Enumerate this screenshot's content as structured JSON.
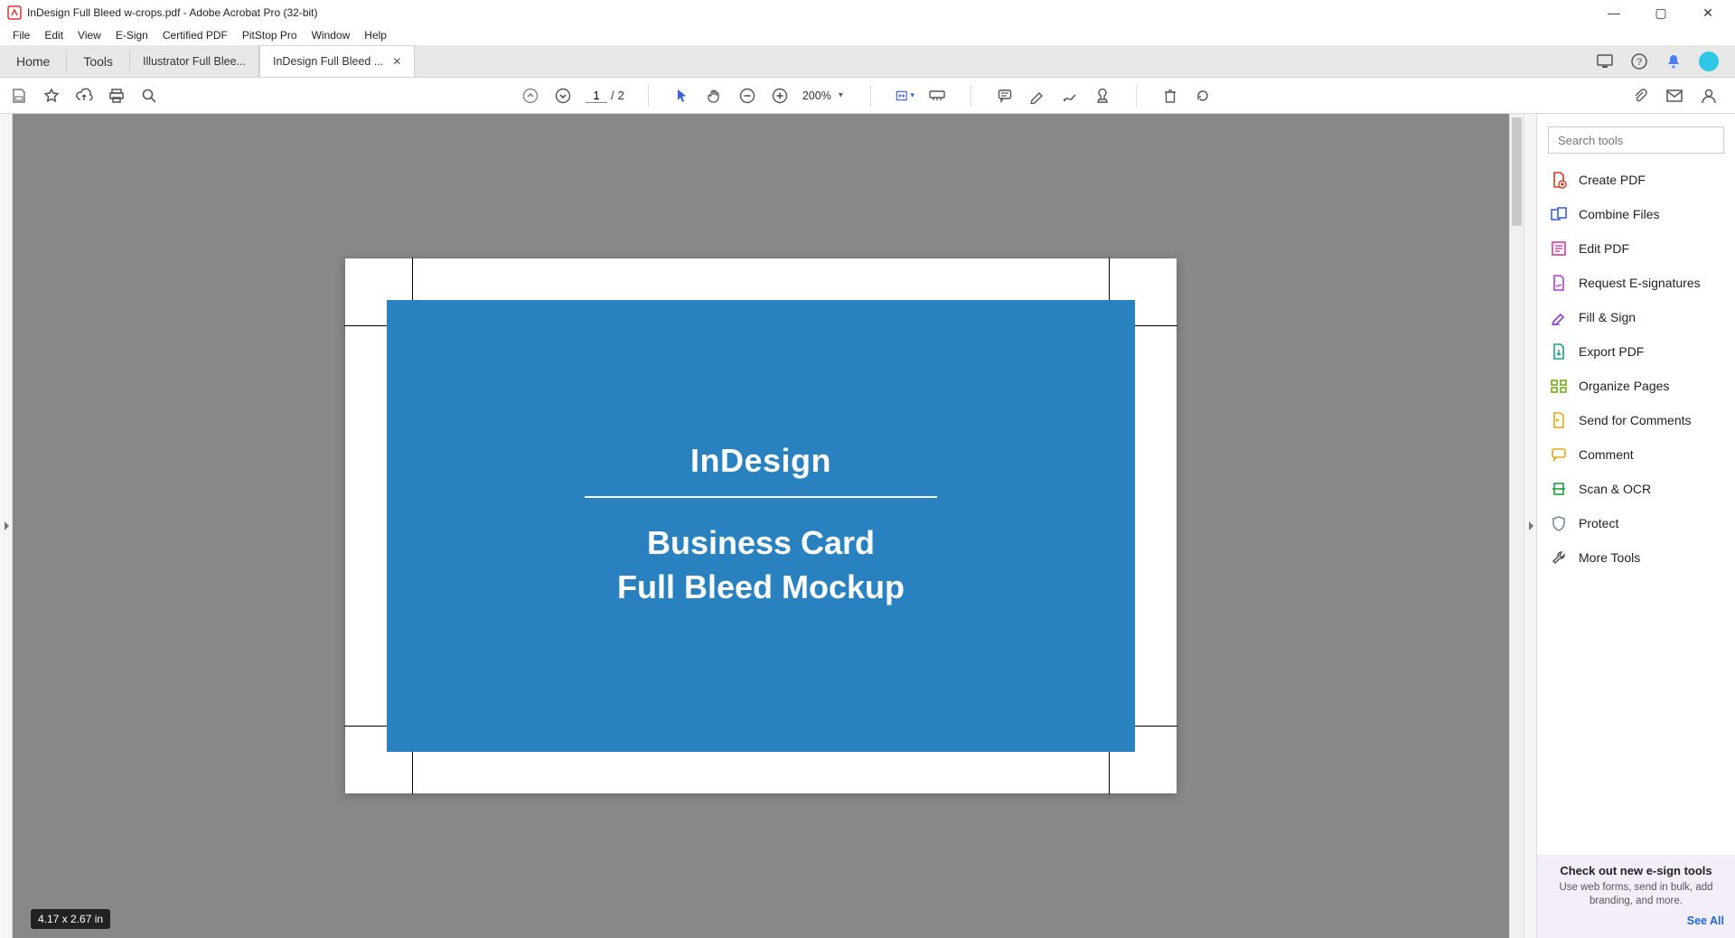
{
  "window": {
    "title": "InDesign Full Bleed w-crops.pdf - Adobe Acrobat Pro (32-bit)"
  },
  "menu": [
    "File",
    "Edit",
    "View",
    "E-Sign",
    "Certified PDF",
    "PitStop Pro",
    "Window",
    "Help"
  ],
  "tabs": {
    "home": "Home",
    "tools": "Tools",
    "docs": [
      {
        "label": "Illustrator Full Blee...",
        "active": false
      },
      {
        "label": "InDesign Full Bleed ...",
        "active": true
      }
    ]
  },
  "toolbar": {
    "page_current": "1",
    "page_sep": "/",
    "page_total": "2",
    "zoom": "200%"
  },
  "document": {
    "title_line": "InDesign",
    "subtitle_line1": "Business Card",
    "subtitle_line2": "Full Bleed Mockup"
  },
  "right_panel": {
    "search_placeholder": "Search tools",
    "tools": [
      {
        "label": "Create PDF",
        "color": "#d63b2a",
        "icon": "file-plus"
      },
      {
        "label": "Combine Files",
        "color": "#3b63d6",
        "icon": "combine"
      },
      {
        "label": "Edit PDF",
        "color": "#d63ba9",
        "icon": "edit-pdf"
      },
      {
        "label": "Request E-signatures",
        "color": "#b23bd6",
        "icon": "signature"
      },
      {
        "label": "Fill & Sign",
        "color": "#8a3bd6",
        "icon": "pen"
      },
      {
        "label": "Export PDF",
        "color": "#1e9e8a",
        "icon": "export"
      },
      {
        "label": "Organize Pages",
        "color": "#6aa50f",
        "icon": "organize"
      },
      {
        "label": "Send for Comments",
        "color": "#e6a817",
        "icon": "send-comment"
      },
      {
        "label": "Comment",
        "color": "#e6a817",
        "icon": "comment"
      },
      {
        "label": "Scan & OCR",
        "color": "#1e9e3d",
        "icon": "scan"
      },
      {
        "label": "Protect",
        "color": "#7a8aa0",
        "icon": "shield"
      },
      {
        "label": "More Tools",
        "color": "#555",
        "icon": "wrench"
      }
    ],
    "promo_title": "Check out new e-sign tools",
    "promo_desc": "Use web forms, send in bulk, add branding, and more.",
    "promo_link": "See All"
  },
  "status": {
    "dimensions": "4.17 x 2.67 in"
  }
}
